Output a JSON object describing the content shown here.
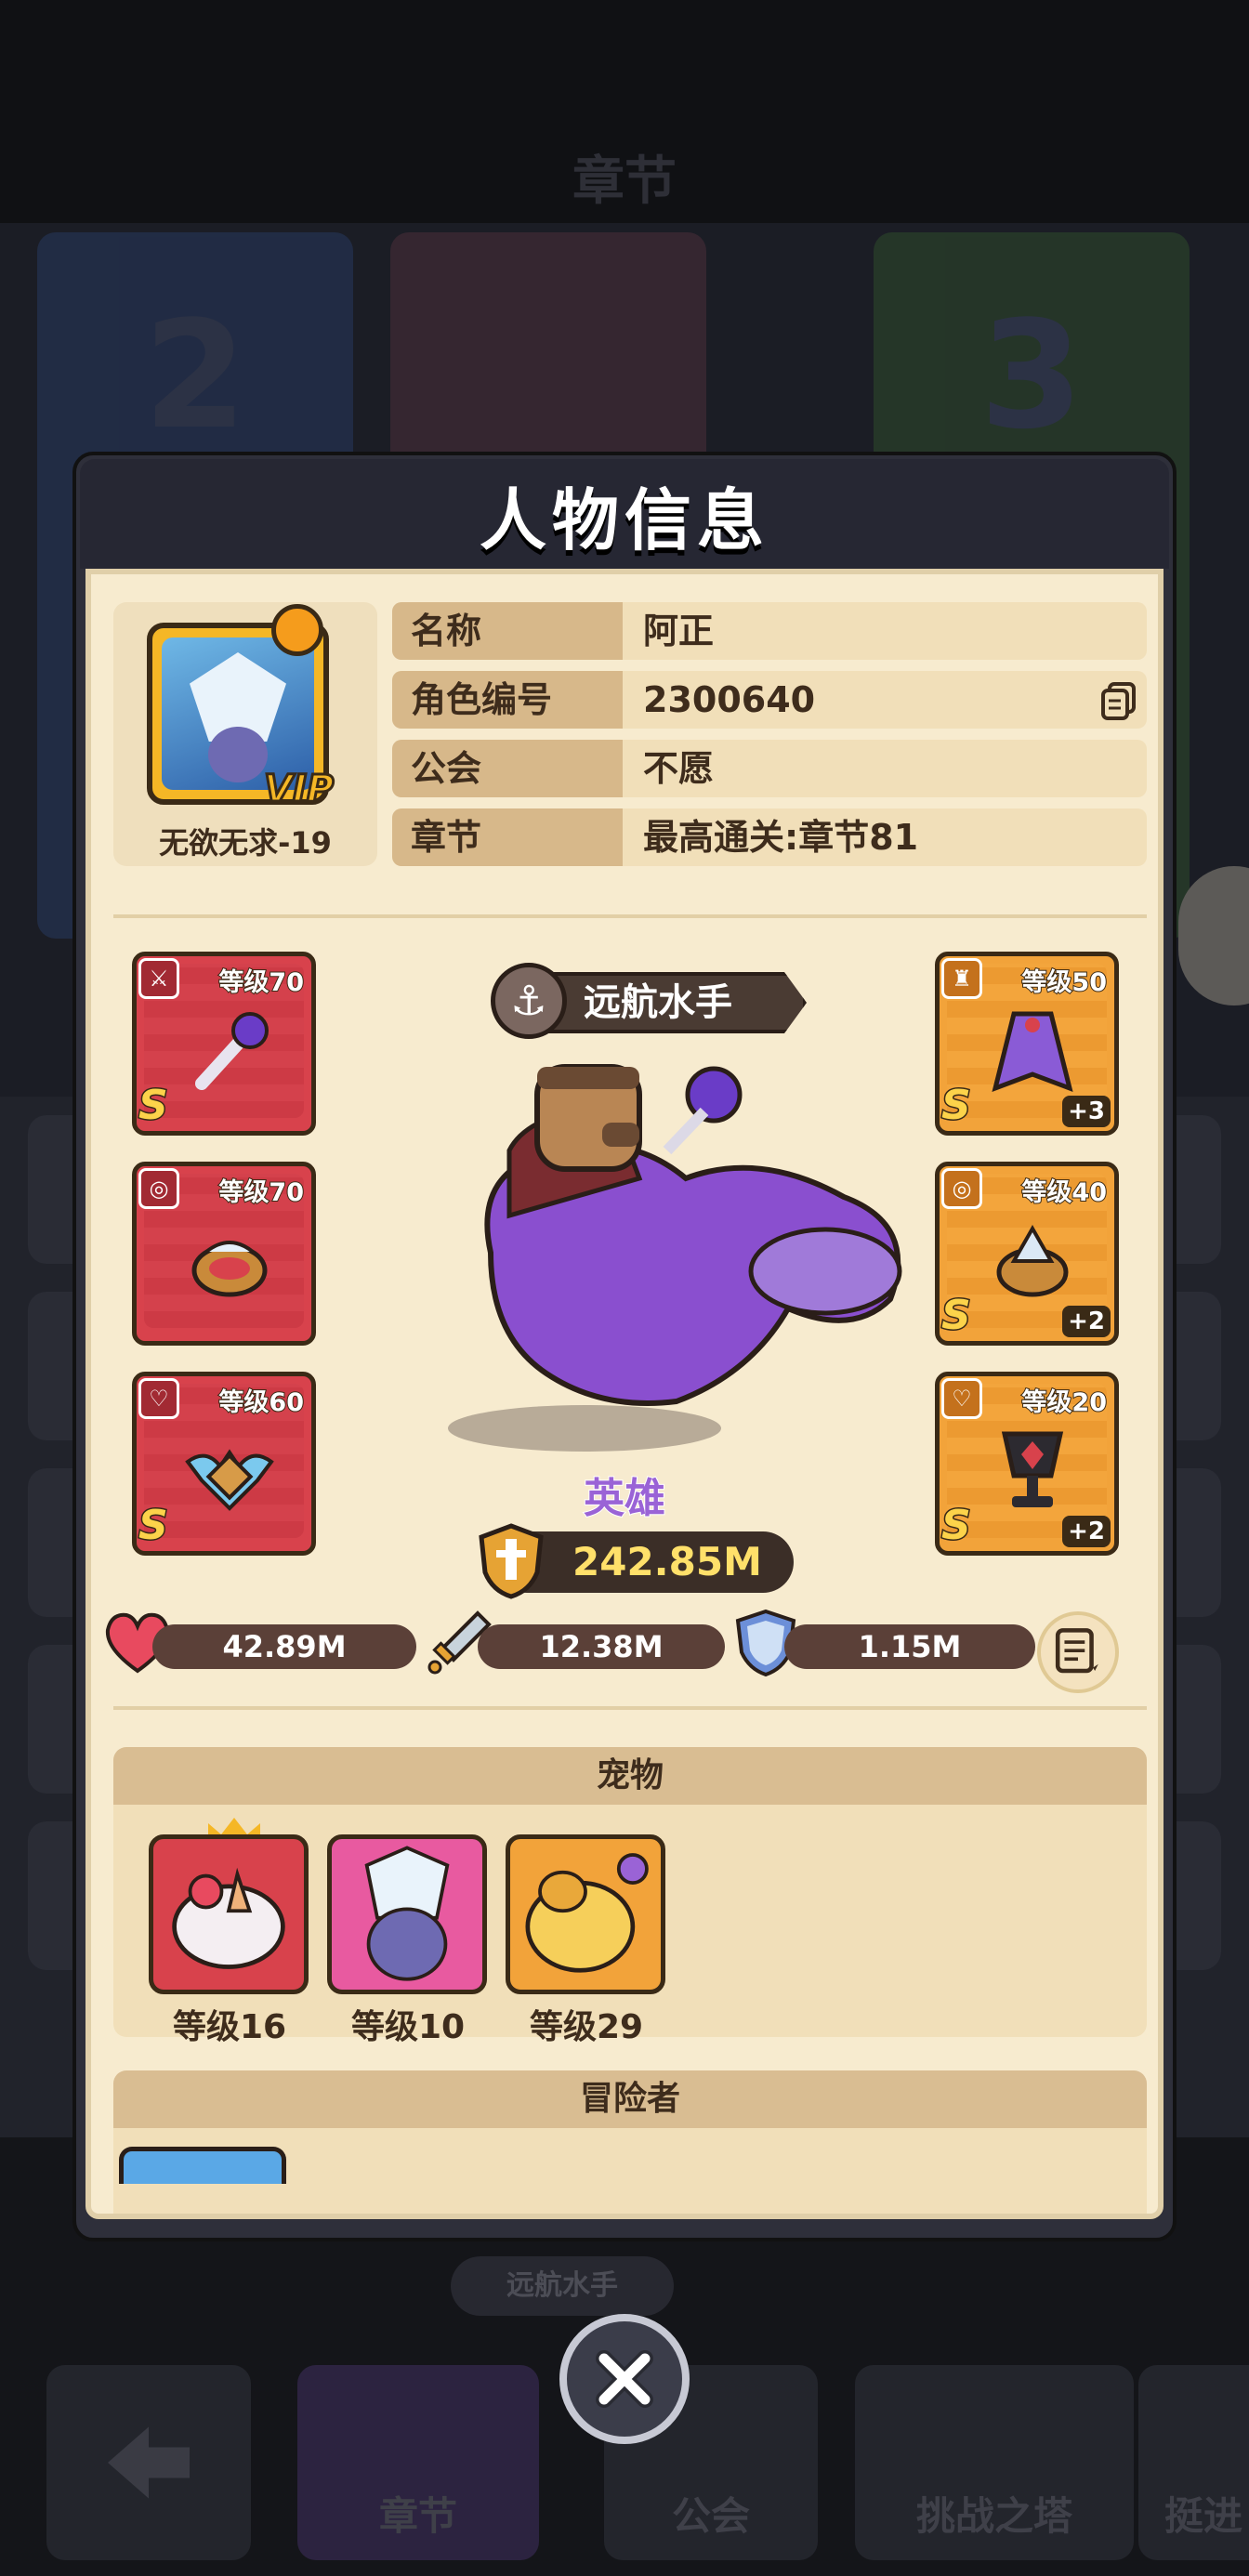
{
  "background": {
    "title": "章节",
    "chapter_cards": [
      "2",
      "",
      "3"
    ],
    "player_chip": "远航水手",
    "nav": [
      "章节",
      "公会",
      "挑战之塔",
      "挺进"
    ]
  },
  "modal": {
    "title": "人物信息",
    "avatar": {
      "name": "无欲无求-19",
      "badge": "VIP"
    },
    "info": [
      {
        "label": "名称",
        "value": "阿正"
      },
      {
        "label": "角色编号",
        "value": "2300640"
      },
      {
        "label": "公会",
        "value": "不愿"
      },
      {
        "label": "章节",
        "value": "最高通关:章节81"
      }
    ],
    "equipment_left": [
      {
        "level": "等级70",
        "rank": "S",
        "slot_icon": "sword-icon",
        "rarity_color": "#d8424c"
      },
      {
        "level": "等级70",
        "rank": "S",
        "slot_icon": "ring-icon",
        "rarity_color": "#d8424c"
      },
      {
        "level": "等级60",
        "rank": "S",
        "slot_icon": "necklace-icon",
        "rarity_color": "#d8424c"
      }
    ],
    "equipment_right": [
      {
        "level": "等级50",
        "rank": "S",
        "plus": "+3",
        "slot_icon": "armor-icon",
        "rarity_color": "#f2a33a"
      },
      {
        "level": "等级40",
        "rank": "S",
        "plus": "+2",
        "slot_icon": "ring-icon",
        "rarity_color": "#f2a33a"
      },
      {
        "level": "等级20",
        "rank": "S",
        "plus": "+2",
        "slot_icon": "necklace-icon",
        "rarity_color": "#f2a33a"
      }
    ],
    "hero": {
      "title": "远航水手",
      "rank_label": "英雄",
      "power": "242.85M"
    },
    "stats": {
      "hp": "42.89M",
      "attack": "12.38M",
      "defense": "1.15M"
    },
    "pets": {
      "section_title": "宠物",
      "items": [
        {
          "level": "等级16",
          "color": "#d8424c"
        },
        {
          "level": "等级10",
          "color": "#e85aa0"
        },
        {
          "level": "等级29",
          "color": "#f2a33a"
        }
      ]
    },
    "adventurers": {
      "section_title": "冒险者"
    }
  }
}
